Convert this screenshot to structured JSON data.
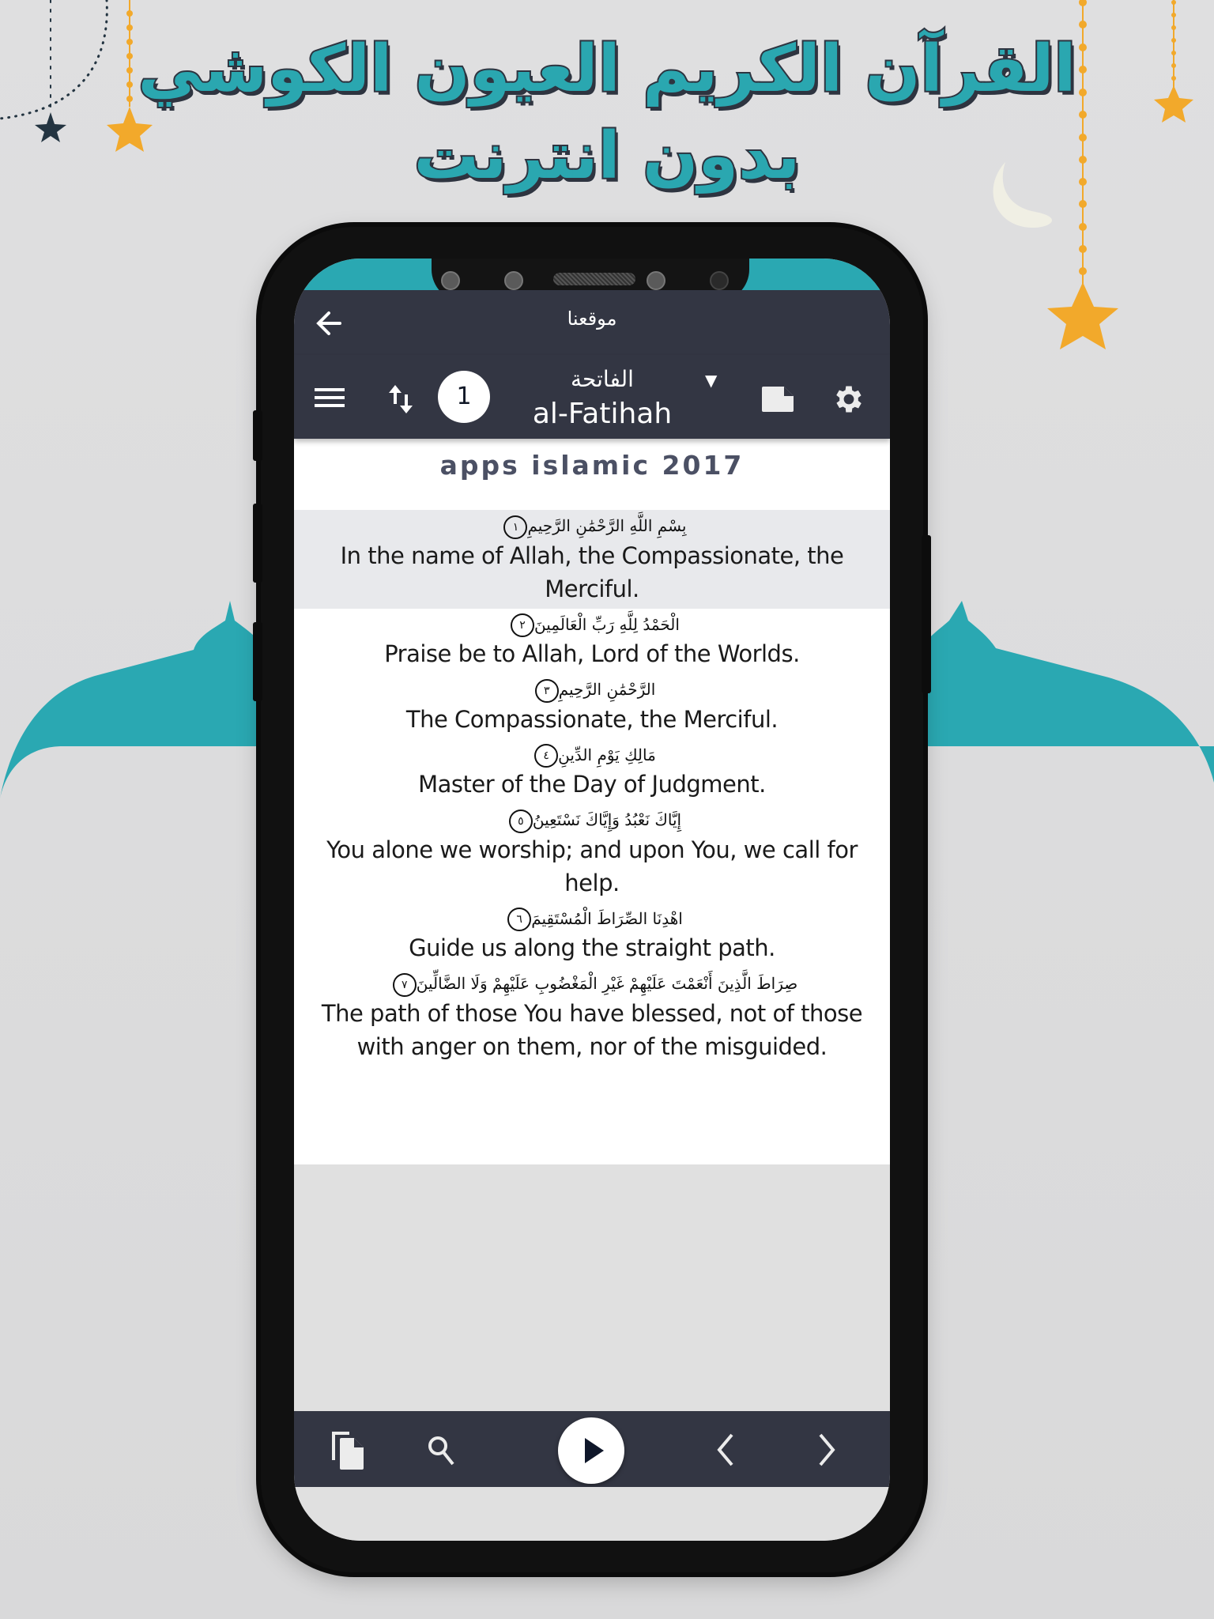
{
  "promo": {
    "title_line1": "القرآن الكريم العيون الكوشي",
    "title_line2": "بدون انترنت"
  },
  "colors": {
    "accent": "#2aa8b2",
    "bar": "#333643",
    "star_gold": "#f2a92b",
    "star_dark": "#233441",
    "moon": "#f0efe4"
  },
  "app": {
    "topbar": {
      "back_icon": "arrow-left-icon",
      "title": "موقعنا"
    },
    "toolbar": {
      "menu_icon": "hamburger-menu-icon",
      "sort_icon": "swap-vertical-icon",
      "sura_number": "1",
      "sura_name_ar": "الفاتحة",
      "sura_name_en": "al-Fatihah",
      "dropdown_caret": "▼",
      "bookmark_icon": "note-icon",
      "settings_icon": "gear-icon"
    },
    "content": {
      "brand": "apps islamic 2017",
      "verses": [
        {
          "num": "١",
          "ar": "بِسْمِ اللَّهِ الرَّحْمَٰنِ الرَّحِيمِ",
          "en": "In the name of Allah, the Compassionate, the Merciful.",
          "active": true
        },
        {
          "num": "٢",
          "ar": "الْحَمْدُ لِلَّهِ رَبِّ الْعَالَمِينَ",
          "en": "Praise be to Allah, Lord of the Worlds.",
          "active": false
        },
        {
          "num": "٣",
          "ar": "الرَّحْمَٰنِ الرَّحِيمِ",
          "en": "The Compassionate, the Merciful.",
          "active": false
        },
        {
          "num": "٤",
          "ar": "مَالِكِ يَوْمِ الدِّينِ",
          "en": "Master of the Day of Judgment.",
          "active": false
        },
        {
          "num": "٥",
          "ar": "إِيَّاكَ نَعْبُدُ وَإِيَّاكَ نَسْتَعِينُ",
          "en": "You alone we worship; and upon You, we call for help.",
          "active": false
        },
        {
          "num": "٦",
          "ar": "اهْدِنَا الصِّرَاطَ الْمُسْتَقِيمَ",
          "en": "Guide us along the straight path.",
          "active": false
        },
        {
          "num": "٧",
          "ar": "صِرَاطَ الَّذِينَ أَنْعَمْتَ عَلَيْهِمْ غَيْرِ الْمَغْضُوبِ عَلَيْهِمْ وَلَا الضَّالِّينَ",
          "en": "The path of those You have blessed, not of those with anger on them, nor of the misguided.",
          "active": false
        }
      ]
    },
    "bottombar": {
      "copy_icon": "copy-icon",
      "search_icon": "search-icon",
      "play_icon": "play-icon",
      "prev_icon": "chevron-left-icon",
      "next_icon": "chevron-right-icon"
    }
  }
}
